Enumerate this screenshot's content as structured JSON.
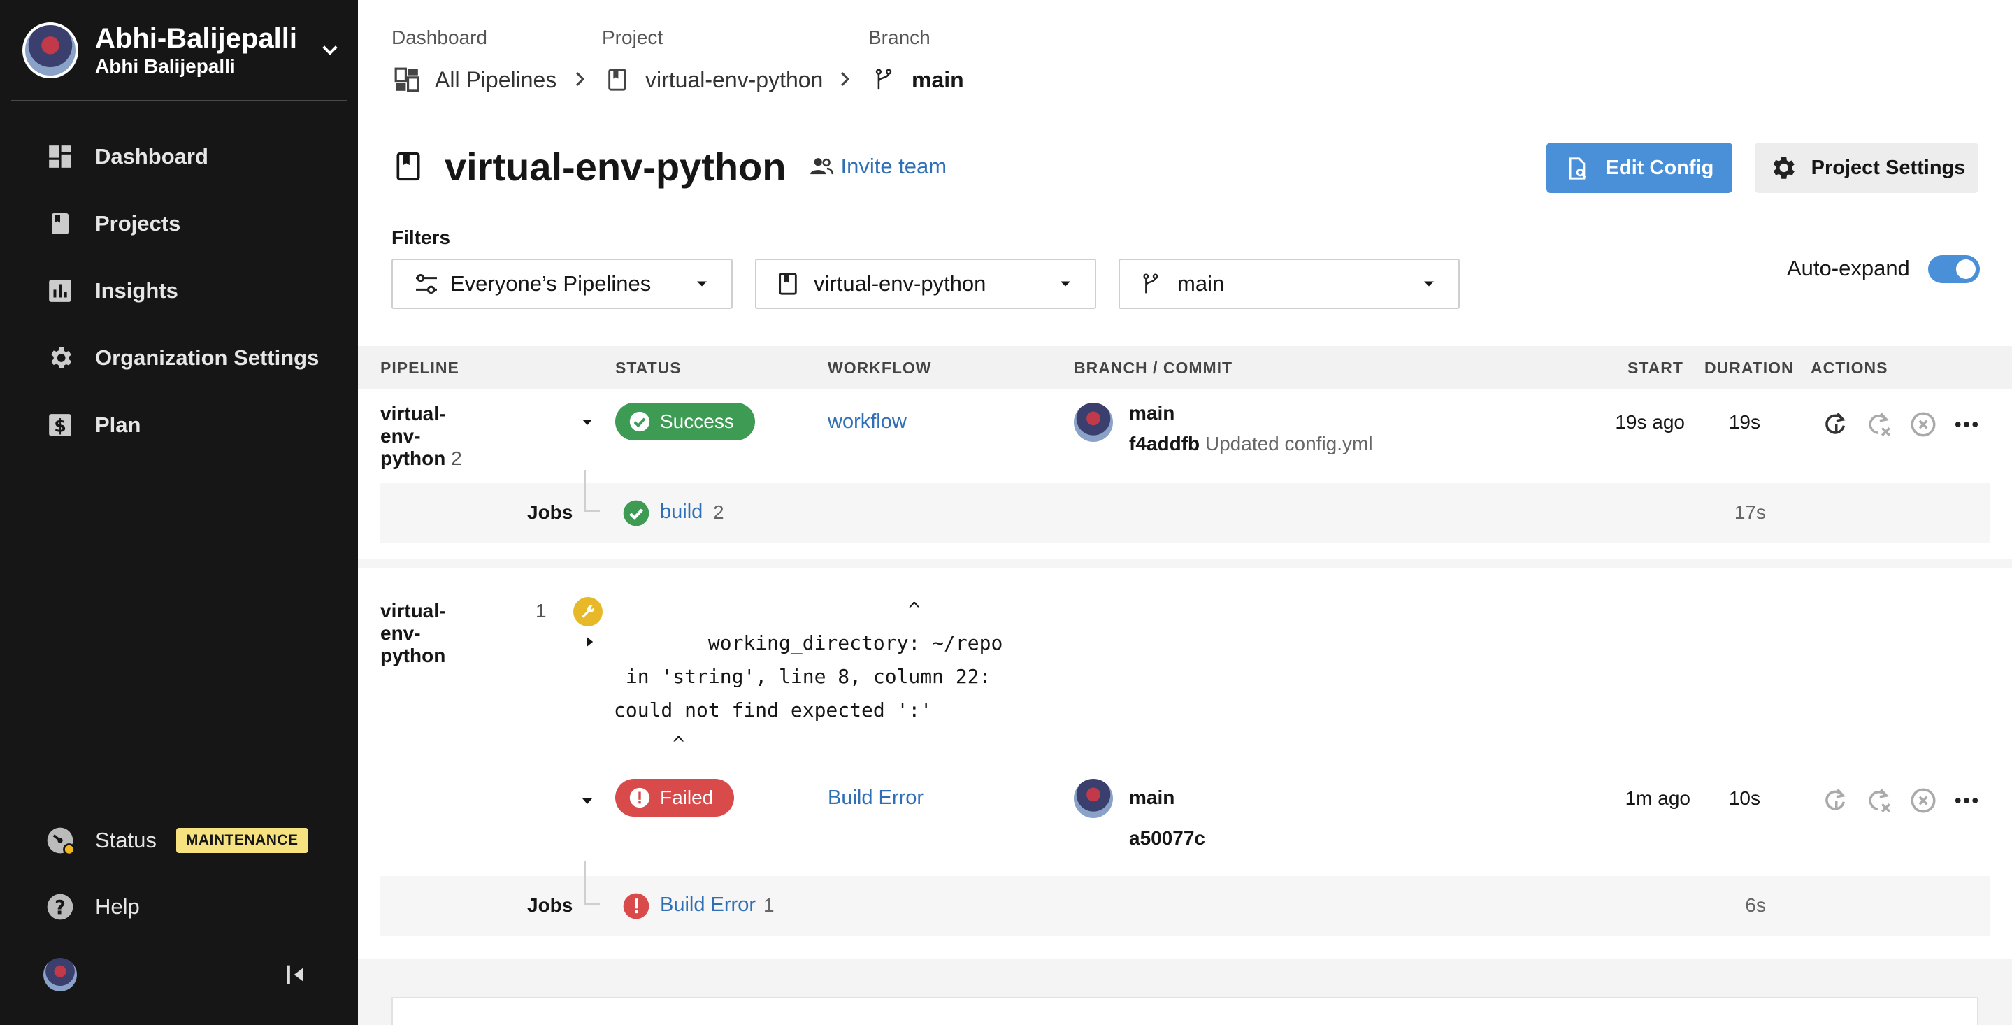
{
  "account": {
    "name": "Abhi-Balijepalli",
    "subname": "Abhi Balijepalli"
  },
  "sidebar": {
    "items": [
      {
        "label": "Dashboard",
        "icon": "dashboard-icon"
      },
      {
        "label": "Projects",
        "icon": "projects-icon"
      },
      {
        "label": "Insights",
        "icon": "insights-icon"
      },
      {
        "label": "Organization Settings",
        "icon": "gear-icon"
      },
      {
        "label": "Plan",
        "icon": "dollar-icon"
      }
    ],
    "status_label": "Status",
    "status_badge": "MAINTENANCE",
    "help_label": "Help"
  },
  "breadcrumb": {
    "dashboard_label": "Dashboard",
    "dashboard_value": "All Pipelines",
    "project_label": "Project",
    "project_value": "virtual-env-python",
    "branch_label": "Branch",
    "branch_value": "main"
  },
  "header": {
    "title": "virtual-env-python",
    "invite": "Invite team",
    "edit_config": "Edit Config",
    "project_settings": "Project Settings"
  },
  "filters": {
    "label": "Filters",
    "pipelines": "Everyone’s Pipelines",
    "project": "virtual-env-python",
    "branch": "main",
    "auto_expand_label": "Auto-expand",
    "auto_expand_on": true
  },
  "table": {
    "columns": [
      "PIPELINE",
      "STATUS",
      "WORKFLOW",
      "BRANCH / COMMIT",
      "START",
      "DURATION",
      "ACTIONS"
    ],
    "rows": [
      {
        "pipeline": "virtual-env-python",
        "pipeline_num": "2",
        "status": "Success",
        "workflow": "workflow",
        "branch": "main",
        "commit_hash": "f4addfb",
        "commit_msg": "Updated config.yml",
        "start": "19s ago",
        "duration": "19s",
        "jobs_label": "Jobs",
        "job_name": "build",
        "job_num": "2",
        "job_duration": "17s"
      },
      {
        "pipeline": "virtual-env-python",
        "pipeline_num": "1",
        "error_message": "                         ^\n        working_directory: ~/repo\n in 'string', line 8, column 22:\ncould not find expected ':'\n     ^",
        "status": "Failed",
        "workflow": "Build Error",
        "branch": "main",
        "commit_hash": "a50077c",
        "start": "1m ago",
        "duration": "10s",
        "jobs_label": "Jobs",
        "job_name": "Build Error",
        "job_num": "1",
        "job_duration": "6s"
      }
    ]
  },
  "colors": {
    "sidebar_bg": "#161616",
    "accent_blue": "#4a90d9",
    "link_blue": "#2e6fb6",
    "success_green": "#3d9b53",
    "failed_red": "#d94a4a",
    "maintenance_yellow": "#f6e27f"
  }
}
